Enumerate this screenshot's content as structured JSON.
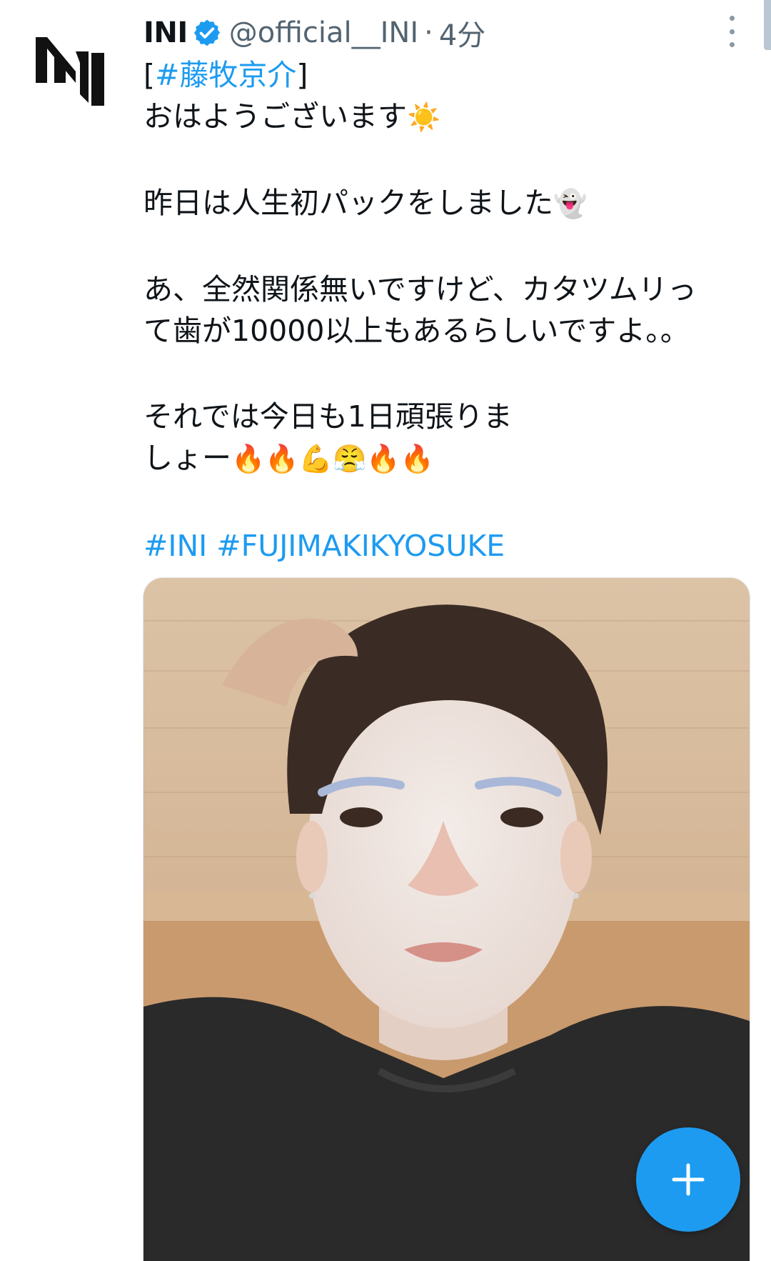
{
  "tweet": {
    "display_name": "INI",
    "handle": "@official__INI",
    "separator": "·",
    "time": "4分",
    "lines": {
      "l1_open": "[",
      "l1_tag": "#藤牧京介",
      "l1_close": "]",
      "l2_text": "おはようございます",
      "l2_emoji": "☀️",
      "l3_text": "昨日は人生初パックをしました",
      "l3_emoji": "👻",
      "l4_text": "あ、全然関係無いですけど、カタツムリっ",
      "l5_text": "て歯が10000以上もあるらしいですよ。。",
      "l6_text": "それでは今日も1日頑張りま",
      "l7_text": "しょー",
      "l7_emojis": [
        "🔥",
        "🔥",
        "💪",
        "😤",
        "🔥",
        "🔥"
      ]
    },
    "hashtags": [
      "#INI",
      "#FUJIMAKIKYOSUKE"
    ]
  },
  "icons": {
    "avatar": "ini-logo-icon",
    "verified": "verified-badge-icon",
    "more": "more-options-icon",
    "compose": "plus-icon"
  },
  "colors": {
    "link": "#1d9bf0",
    "text": "#0f1419",
    "secondary": "#536471",
    "fab": "#1d9bf0"
  }
}
